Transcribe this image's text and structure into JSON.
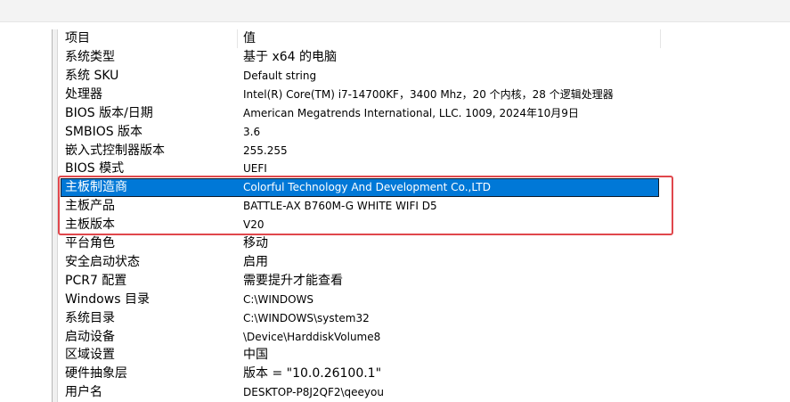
{
  "table": {
    "headers": {
      "item": "项目",
      "value": "值"
    },
    "rows": [
      {
        "item": "系统类型",
        "value": "基于 x64 的电脑",
        "selected": false
      },
      {
        "item": "系统 SKU",
        "value": "Default string",
        "selected": false
      },
      {
        "item": "处理器",
        "value": "Intel(R) Core(TM) i7-14700KF，3400 Mhz，20 个内核，28 个逻辑处理器",
        "selected": false
      },
      {
        "item": "BIOS 版本/日期",
        "value": "American Megatrends International, LLC. 1009, 2024年10月9日",
        "selected": false
      },
      {
        "item": "SMBIOS 版本",
        "value": "3.6",
        "selected": false
      },
      {
        "item": "嵌入式控制器版本",
        "value": "255.255",
        "selected": false
      },
      {
        "item": "BIOS 模式",
        "value": "UEFI",
        "selected": false
      },
      {
        "item": "主板制造商",
        "value": "Colorful Technology And Development Co.,LTD",
        "selected": true
      },
      {
        "item": "主板产品",
        "value": "BATTLE-AX B760M-G WHITE WIFI D5",
        "selected": false
      },
      {
        "item": "主板版本",
        "value": "V20",
        "selected": false
      },
      {
        "item": "平台角色",
        "value": "移动",
        "selected": false
      },
      {
        "item": "安全启动状态",
        "value": "启用",
        "selected": false
      },
      {
        "item": "PCR7 配置",
        "value": "需要提升才能查看",
        "selected": false
      },
      {
        "item": "Windows 目录",
        "value": "C:\\WINDOWS",
        "selected": false
      },
      {
        "item": "系统目录",
        "value": "C:\\WINDOWS\\system32",
        "selected": false
      },
      {
        "item": "启动设备",
        "value": "\\Device\\HarddiskVolume8",
        "selected": false
      },
      {
        "item": "区域设置",
        "value": "中国",
        "selected": false
      },
      {
        "item": "硬件抽象层",
        "value": "版本 = \"10.0.26100.1\"",
        "selected": false
      },
      {
        "item": "用户名",
        "value": "DESKTOP-P8J2QF2\\qeeyou",
        "selected": false
      }
    ]
  },
  "colors": {
    "selection": "#0078d7",
    "annotation_box": "#e0474c"
  }
}
